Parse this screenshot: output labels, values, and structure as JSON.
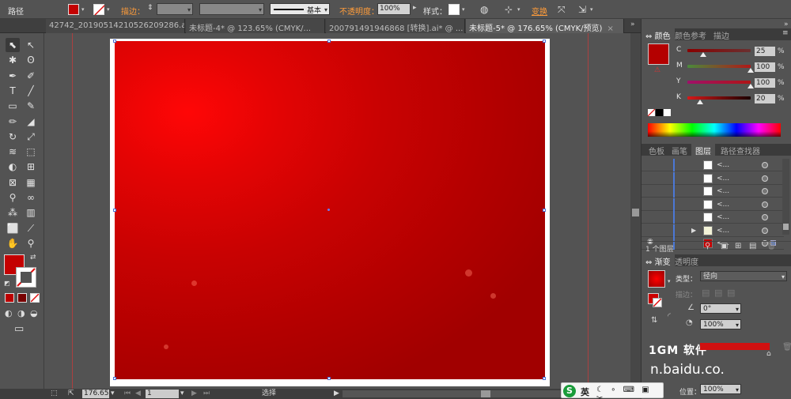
{
  "control_bar": {
    "object_type": "路径",
    "stroke_label": "描边：",
    "brush_preset": "基本",
    "opacity_label": "不透明度：",
    "opacity_value": "100%",
    "style_label": "样式：",
    "transform_label": "变换",
    "fill_color": "#c40202"
  },
  "tabs": [
    {
      "label": "42742_20190514210526209286.ai*"
    },
    {
      "label": "未标题-4* @ 123.65% (CMYK/..."
    },
    {
      "label": "200791491946868 [转换].ai* @ ..."
    },
    {
      "label": "未标题-5* @ 176.65% (CMYK/预览)",
      "active": true
    }
  ],
  "tools": [
    "selection-icon",
    "direct-selection-icon",
    "magic-wand-icon",
    "lasso-icon",
    "pen-icon",
    "curvature-icon",
    "type-icon",
    "line-icon",
    "rectangle-icon",
    "paintbrush-icon",
    "pencil-icon",
    "eraser-icon",
    "rotate-icon",
    "scale-icon",
    "width-icon",
    "free-transform-icon",
    "shape-builder-icon",
    "perspective-icon",
    "mesh-icon",
    "gradient-icon",
    "eyedropper-icon",
    "blend-icon",
    "symbol-sprayer-icon",
    "graph-icon",
    "artboard-icon",
    "slice-icon",
    "hand-icon",
    "zoom-icon"
  ],
  "tool_glyphs": [
    "⬉",
    "↖",
    "✱",
    "ʘ",
    "✒",
    "✐",
    "T",
    "╱",
    "▭",
    "✎",
    "✏",
    "◢",
    "↻",
    "⤢",
    "≋",
    "⬚",
    "◐",
    "⊞",
    "⊠",
    "▦",
    "⚲",
    "∞",
    "⁂",
    "▥",
    "⬜",
    "⟋",
    "✋",
    "⚲"
  ],
  "canvas": {
    "gradient_center": "#ff0606",
    "gradient_edge": "#a10000"
  },
  "status": {
    "zoom": "176.65",
    "artboard_num": "1",
    "tool_name": "选择"
  },
  "color_panel": {
    "tabs": [
      "颜色",
      "颜色参考",
      "描边"
    ],
    "swatch": "#b40000",
    "channels": [
      {
        "label": "C",
        "value": "25",
        "frac": 0.25,
        "gradient": "linear-gradient(to right,#8a0000,#6a3030)"
      },
      {
        "label": "M",
        "value": "100",
        "frac": 1.0,
        "gradient": "linear-gradient(to right,#4a8a3a,#b01818)"
      },
      {
        "label": "Y",
        "value": "100",
        "frac": 1.0,
        "gradient": "linear-gradient(to right,#a0106a,#b01414)"
      },
      {
        "label": "K",
        "value": "20",
        "frac": 0.2,
        "gradient": "linear-gradient(to right,#d81818,#1a0000)"
      }
    ],
    "pct": "%"
  },
  "layers_panel": {
    "tabs": [
      "色板",
      "画笔",
      "图层",
      "路径查找器"
    ],
    "rows": [
      {
        "name": "<...",
        "thumb": "#ffffff"
      },
      {
        "name": "<...",
        "thumb": "#ffffff"
      },
      {
        "name": "<...",
        "thumb": "#ffffff"
      },
      {
        "name": "<...",
        "thumb": "#ffffff"
      },
      {
        "name": "<...",
        "thumb": "#ffffff"
      },
      {
        "name": "<...",
        "thumb": "#f3f3d8",
        "expand": "▶"
      },
      {
        "name": "<...",
        "thumb": "#c40000",
        "eye": "👁"
      }
    ],
    "count_label": "1 个图层"
  },
  "gradient_panel": {
    "tabs": [
      "渐变",
      "透明度"
    ],
    "type_label": "类型：",
    "type_value": "径向",
    "stroke_label": "描边：",
    "angle_value": "0°",
    "aspect_value": "100%",
    "location_label": "位置：",
    "location_value": "100%"
  },
  "watermark": {
    "logo": "1GM 软件",
    "text": "n.baidu.co."
  },
  "ime": {
    "logo": "S",
    "mode": "英",
    "icons": "☾ ∘ ⌨ ▣ ✂"
  }
}
